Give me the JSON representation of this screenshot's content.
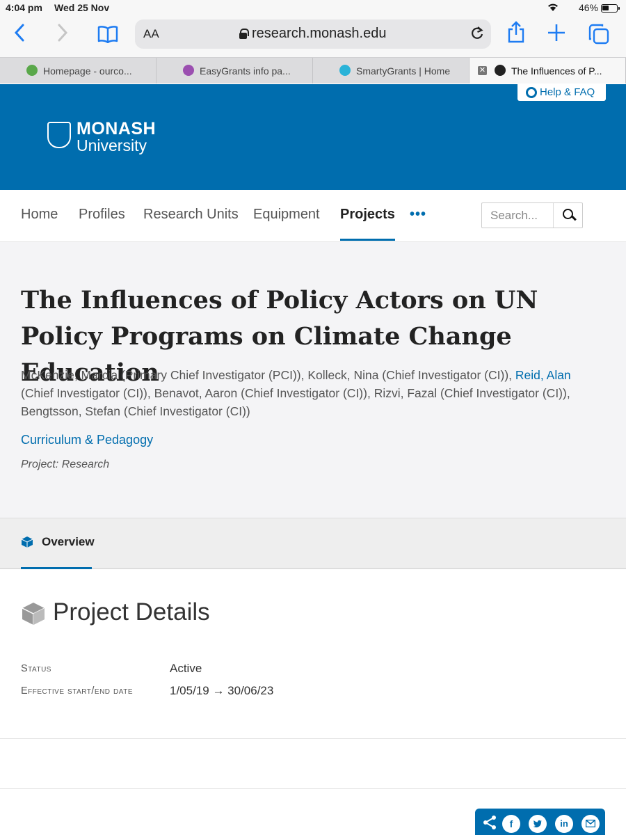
{
  "status": {
    "time": "4:04 pm",
    "date": "Wed 25 Nov",
    "battery": "46%"
  },
  "toolbar": {
    "aa": "AA",
    "url": "research.monash.edu"
  },
  "tabs": [
    {
      "label": "Homepage - ourco...",
      "active": false
    },
    {
      "label": "EasyGrants info pa...",
      "active": false
    },
    {
      "label": "SmartyGrants | Home",
      "active": false
    },
    {
      "label": "The Influences of P...",
      "active": true
    }
  ],
  "header": {
    "help": "Help & FAQ",
    "logo_line1": "MONASH",
    "logo_line2": "University",
    "brand_color": "#006dae"
  },
  "nav": {
    "items": [
      "Home",
      "Profiles",
      "Research Units",
      "Equipment",
      "Projects"
    ],
    "active": "Projects",
    "more": "•••",
    "search_placeholder": "Search..."
  },
  "project": {
    "title": "The Influences of Policy Actors on UN Policy Programs on Climate Change Education",
    "persons_pre": "McKenzie, Marcia (Primary Chief Investigator (PCI)), Kolleck, Nina (Chief Investigator (CI)), ",
    "persons_link": "Reid, Alan",
    "persons_post": " (Chief Investigator (CI)), Benavot, Aaron (Chief Investigator (CI)), Rizvi, Fazal (Chief Investigator (CI)), Bengtsson, Stefan (Chief Investigator (CI))",
    "org": "Curriculum & Pedagogy",
    "type": "Project: Research"
  },
  "overview_tab": "Overview",
  "details": {
    "title": "Project Details",
    "rows": [
      {
        "label": "Status",
        "value": "Active"
      },
      {
        "label": "Effective start/end date",
        "value": "1/05/19 → 30/06/23"
      }
    ]
  },
  "share": {
    "icons": [
      "share-icon",
      "facebook-icon",
      "twitter-icon",
      "linkedin-icon",
      "email-icon"
    ],
    "facebook": "f",
    "linkedin": "in"
  }
}
